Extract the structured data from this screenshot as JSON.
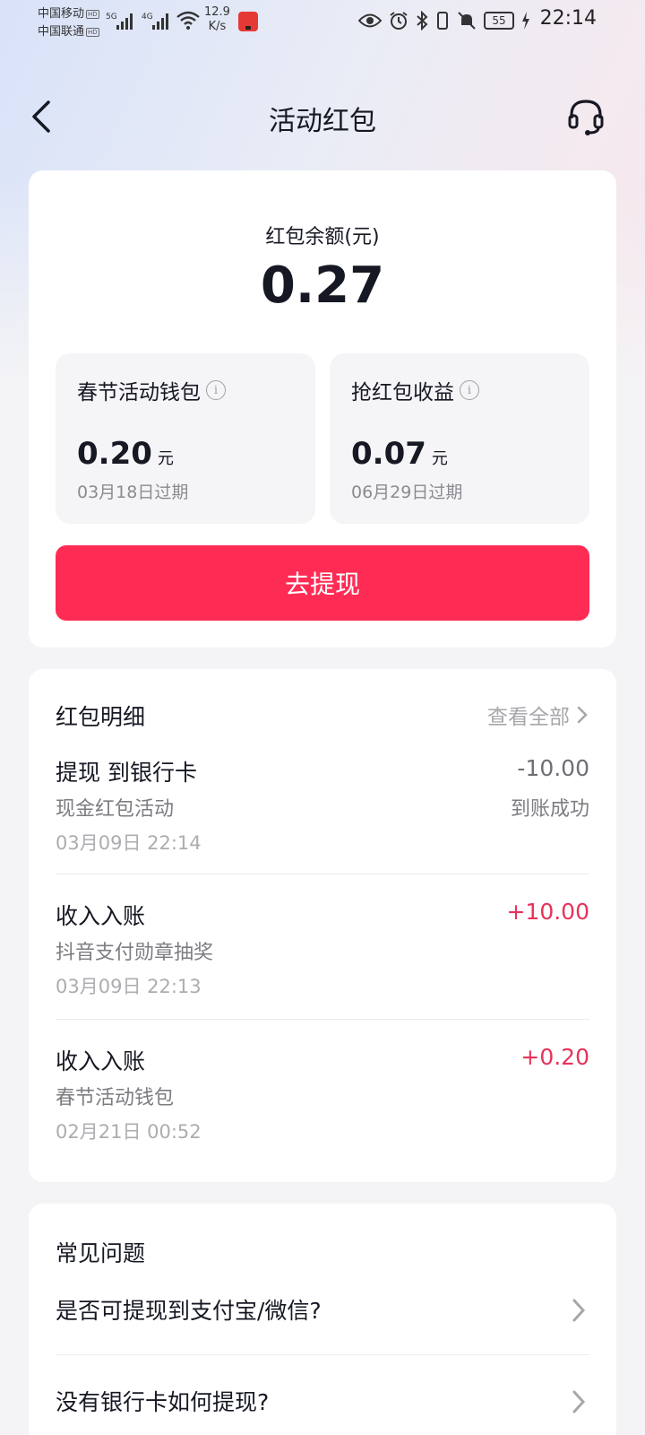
{
  "status_bar": {
    "carrier1": "中国移动",
    "carrier2": "中国联通",
    "carrier_tag": "HD",
    "net1": "5G",
    "net2": "4G",
    "speed_value": "12.9",
    "speed_unit": "K/s",
    "battery": "55",
    "time": "22:14"
  },
  "header": {
    "title": "活动红包"
  },
  "balance": {
    "label": "红包余额(元)",
    "amount": "0.27",
    "wallets": [
      {
        "title": "春节活动钱包",
        "amount": "0.20",
        "unit": "元",
        "expire": "03月18日过期"
      },
      {
        "title": "抢红包收益",
        "amount": "0.07",
        "unit": "元",
        "expire": "06月29日过期"
      }
    ],
    "withdraw_label": "去提现"
  },
  "details": {
    "title": "红包明细",
    "view_all": "查看全部",
    "records": [
      {
        "title": "提现 到银行卡",
        "source": "现金红包活动",
        "time": "03月09日 22:14",
        "amount": "-10.00",
        "status": "到账成功"
      },
      {
        "title": "收入入账",
        "source": "抖音支付勋章抽奖",
        "time": "03月09日 22:13",
        "amount": "+10.00",
        "status": ""
      },
      {
        "title": "收入入账",
        "source": "春节活动钱包",
        "time": "02月21日 00:52",
        "amount": "+0.20",
        "status": ""
      }
    ]
  },
  "faq": {
    "title": "常见问题",
    "items": [
      {
        "question": "是否可提现到支付宝/微信?"
      },
      {
        "question": "没有银行卡如何提现?"
      }
    ]
  },
  "colors": {
    "accent": "#fe2c55",
    "income": "#e8325a",
    "text": "#161823",
    "muted": "#7c7d82"
  }
}
